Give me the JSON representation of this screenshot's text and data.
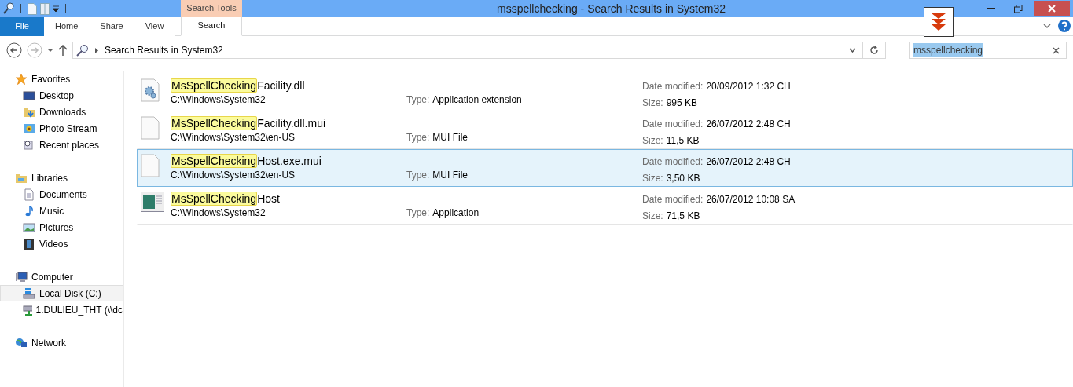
{
  "window": {
    "title": "msspellchecking - Search Results in System32"
  },
  "ribbon": {
    "context_label": "Search Tools",
    "tabs": [
      {
        "label": "File",
        "kind": "file",
        "selected": false
      },
      {
        "label": "Home",
        "kind": "tab",
        "selected": false
      },
      {
        "label": "Share",
        "kind": "tab",
        "selected": false
      },
      {
        "label": "View",
        "kind": "tab",
        "selected": false
      },
      {
        "label": "Search",
        "kind": "contextual",
        "selected": true
      }
    ]
  },
  "address": {
    "path": "Search Results in System32"
  },
  "search": {
    "value": "msspellchecking"
  },
  "sidebar": {
    "groups": [
      {
        "label": "Favorites",
        "kind": "favorites",
        "children": [
          {
            "label": "Desktop",
            "kind": "desktop",
            "selected": false
          },
          {
            "label": "Downloads",
            "kind": "downloads",
            "selected": false
          },
          {
            "label": "Photo Stream",
            "kind": "photo",
            "selected": false
          },
          {
            "label": "Recent places",
            "kind": "recent",
            "selected": false
          }
        ]
      },
      {
        "label": "Libraries",
        "kind": "libraries",
        "children": [
          {
            "label": "Documents",
            "kind": "documents",
            "selected": false
          },
          {
            "label": "Music",
            "kind": "music",
            "selected": false
          },
          {
            "label": "Pictures",
            "kind": "pictures",
            "selected": false
          },
          {
            "label": "Videos",
            "kind": "videos",
            "selected": false
          }
        ]
      },
      {
        "label": "Computer",
        "kind": "computer",
        "children": [
          {
            "label": "Local Disk (C:)",
            "kind": "disk",
            "selected": true
          },
          {
            "label": "1.DULIEU_THT (\\\\dc",
            "kind": "netdrive",
            "selected": false
          }
        ]
      },
      {
        "label": "Network",
        "kind": "network"
      }
    ]
  },
  "results": [
    {
      "kind": "dll",
      "name_match": "MsSpellChecking",
      "name_rest": "Facility.dll",
      "path": "C:\\Windows\\System32",
      "type_label": "Type:",
      "type": "Application extension",
      "date_label": "Date modified:",
      "date": "20/09/2012 1:32 CH",
      "size_label": "Size:",
      "size": "995 KB",
      "selected": false
    },
    {
      "kind": "file",
      "name_match": "MsSpellChecking",
      "name_rest": "Facility.dll.mui",
      "path": "C:\\Windows\\System32\\en-US",
      "type_label": "Type:",
      "type": "MUI File",
      "date_label": "Date modified:",
      "date": "26/07/2012 2:48 CH",
      "size_label": "Size:",
      "size": "11,5 KB",
      "selected": false
    },
    {
      "kind": "file",
      "name_match": "MsSpellChecking",
      "name_rest": "Host.exe.mui",
      "path": "C:\\Windows\\System32\\en-US",
      "type_label": "Type:",
      "type": "MUI File",
      "date_label": "Date modified:",
      "date": "26/07/2012 2:48 CH",
      "size_label": "Size:",
      "size": "3,50 KB",
      "selected": true
    },
    {
      "kind": "app",
      "name_match": "MsSpellChecking",
      "name_rest": "Host",
      "path": "C:\\Windows\\System32",
      "type_label": "Type:",
      "type": "Application",
      "date_label": "Date modified:",
      "date": "26/07/2012 10:08 SA",
      "size_label": "Size:",
      "size": "71,5 KB",
      "selected": false
    }
  ]
}
